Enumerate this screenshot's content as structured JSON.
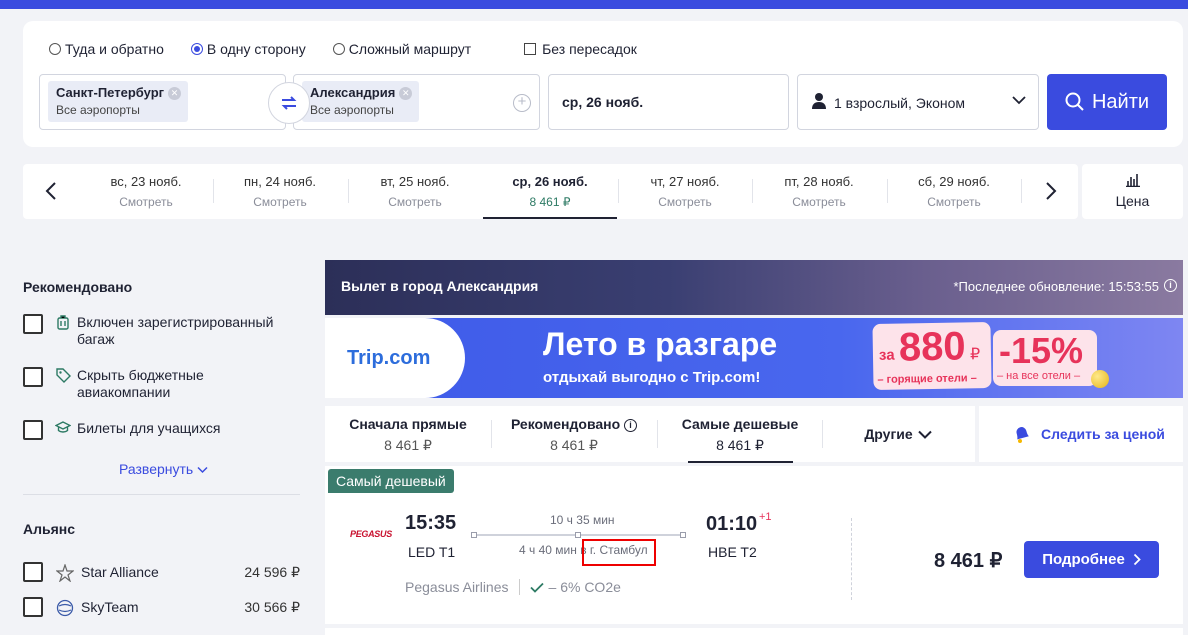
{
  "trip_types": [
    {
      "label": "Туда и обратно",
      "selected": false
    },
    {
      "label": "В одну сторону",
      "selected": true
    },
    {
      "label": "Сложный маршрут",
      "selected": false
    }
  ],
  "nonstop_label": "Без пересадок",
  "from": {
    "city": "Санкт-Петербург",
    "airports": "Все аэропорты"
  },
  "to": {
    "city": "Александрия",
    "airports": "Все аэропорты"
  },
  "date": "ср, 26 нояб.",
  "passengers": "1 взрослый, Эконом",
  "search_button": "Найти",
  "date_strip": {
    "days": [
      {
        "label": "вс, 23 нояб.",
        "price": "Смотреть",
        "active": false
      },
      {
        "label": "пн, 24 нояб.",
        "price": "Смотреть",
        "active": false
      },
      {
        "label": "вт, 25 нояб.",
        "price": "Смотреть",
        "active": false
      },
      {
        "label": "ср, 26 нояб.",
        "price": "8 461 ₽",
        "active": true
      },
      {
        "label": "чт, 27 нояб.",
        "price": "Смотреть",
        "active": false
      },
      {
        "label": "пт, 28 нояб.",
        "price": "Смотреть",
        "active": false
      },
      {
        "label": "сб, 29 нояб.",
        "price": "Смотреть",
        "active": false
      }
    ],
    "price_button": "Цена"
  },
  "sidebar": {
    "recommended_title": "Рекомендовано",
    "filters": [
      {
        "label": "Включен зарегистрированный багаж",
        "icon": "luggage-icon"
      },
      {
        "label": "Скрыть бюджетные авиакомпании",
        "icon": "tag-icon"
      },
      {
        "label": "Билеты для учащихся",
        "icon": "graduation-cap-icon"
      }
    ],
    "expand_label": "Развернуть",
    "alliance_title": "Альянс",
    "alliances": [
      {
        "name": "Star Alliance",
        "price": "24 596 ₽",
        "icon": "star-alliance-icon"
      },
      {
        "name": "SkyTeam",
        "price": "30 566 ₽",
        "icon": "skyteam-icon"
      }
    ]
  },
  "results_header": {
    "title": "Вылет в город Александрия",
    "updated": "*Последнее обновление: 15:53:55"
  },
  "banner": {
    "logo": "Trip.com",
    "headline": "Лето в разгаре",
    "subline": "отдыхай выгодно с Trip.com!",
    "promo1_prefix": "за",
    "promo1_value": "880",
    "promo1_currency": "₽",
    "promo1_caption": "– горящие отели –",
    "promo2_value": "-15%",
    "promo2_caption": "– на все отели –"
  },
  "sort_tabs": [
    {
      "title": "Сначала прямые",
      "price": "8 461 ₽",
      "active": false
    },
    {
      "title": "Рекомендовано",
      "price": "8 461 ₽",
      "active": false
    },
    {
      "title": "Самые дешевые",
      "price": "8 461 ₽",
      "active": true
    }
  ],
  "other_tab": "Другие",
  "track_price": "Следить за ценой",
  "ticket": {
    "badge": "Самый дешевый",
    "airline_logo": "PEGASUS",
    "dep_time": "15:35",
    "dep_airport": "LED T1",
    "duration": "10 ч 35 мин",
    "layover": "4 ч 40 мин в г. Стамбул",
    "arr_time": "01:10",
    "day_offset": "+1",
    "arr_airport": "HBE T2",
    "airline": "Pegasus Airlines",
    "co2": "– 6% CO2e",
    "price": "8 461 ₽",
    "details_button": "Подробнее"
  },
  "colors": {
    "accent": "#3a4bdf",
    "badge": "#3b7c6d",
    "promo": "#e7335a"
  }
}
